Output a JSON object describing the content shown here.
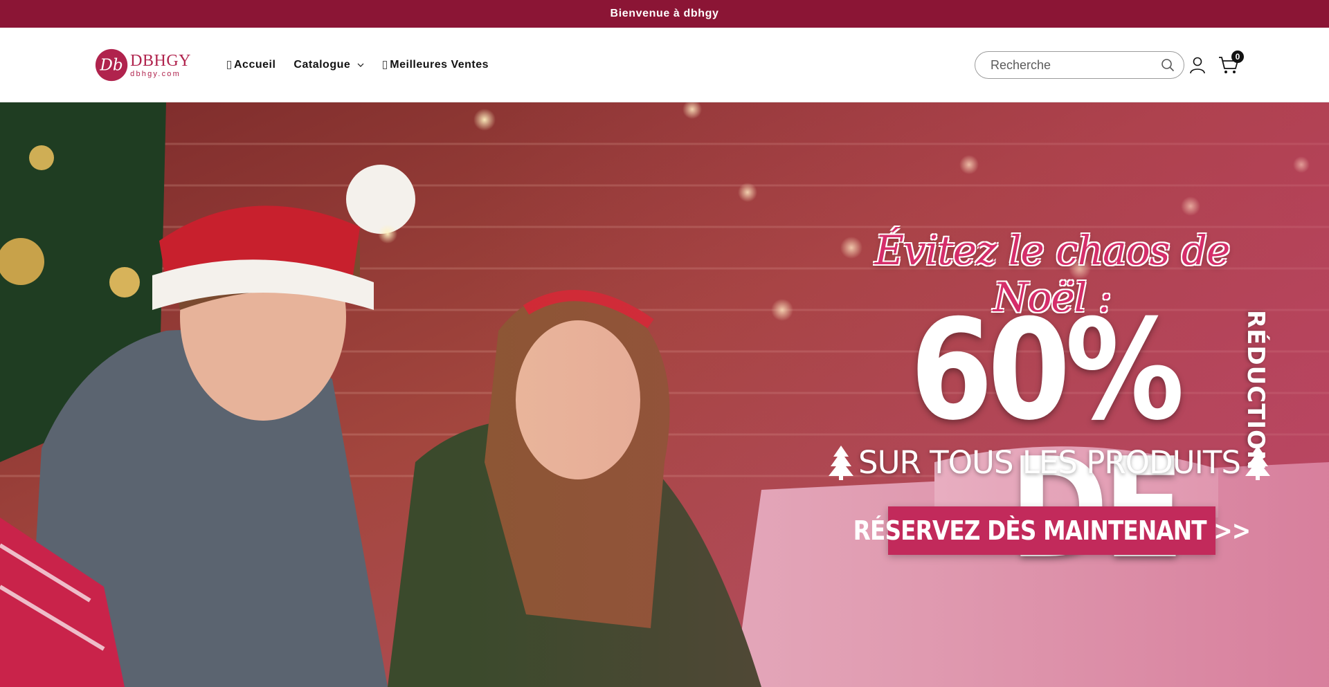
{
  "announcement": {
    "text": "Bienvenue à dbhgy"
  },
  "logo": {
    "name": "DBHGY",
    "domain": "dbhgy.com",
    "monogram": "Db"
  },
  "nav": {
    "items": [
      {
        "label": "Accueil",
        "glyph": ""
      },
      {
        "label": "Catalogue",
        "dropdown": true
      },
      {
        "label": "Meilleures Ventes",
        "glyph": ""
      }
    ]
  },
  "search": {
    "placeholder": "Recherche",
    "value": "",
    "icon": "search-icon"
  },
  "account": {
    "icon": "user-icon"
  },
  "cart": {
    "icon": "cart-icon",
    "count": "0"
  },
  "hero": {
    "kicker": "Évitez le chaos de Noël :",
    "big_text": "60% DE",
    "vertical_text": "RÉDUCTION",
    "subline": "SUR TOUS LES PRODUITS",
    "cta": "RÉSERVEZ DÈS MAINTENANT >>",
    "accent_color": "#c22a5b"
  },
  "colors": {
    "brand": "#8b1535",
    "logo": "#b0234d",
    "text": "#121212"
  }
}
